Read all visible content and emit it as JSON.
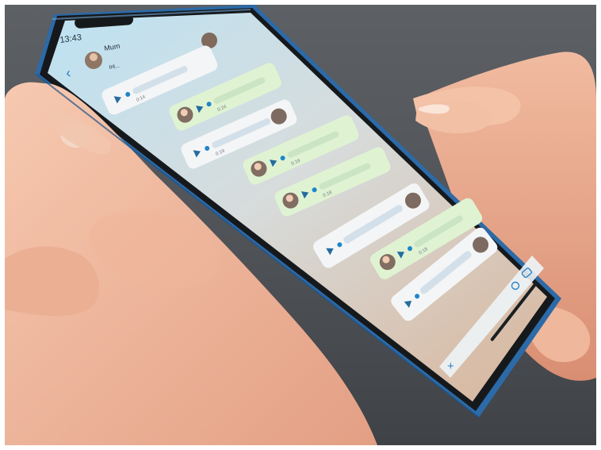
{
  "status_bar": {
    "time": "13:43"
  },
  "chat": {
    "contact_name": "Mum",
    "contact_status": "Inl...",
    "back_icon": "chevron-left-icon",
    "play_icon": "play-triangle-icon",
    "voice_messages": [
      {
        "sender": "contact",
        "duration": "0:14"
      },
      {
        "sender": "me",
        "duration": "0:24"
      },
      {
        "sender": "contact",
        "duration": "0:19"
      },
      {
        "sender": "me",
        "duration": "0:19"
      },
      {
        "sender": "me",
        "duration": "0:19"
      },
      {
        "sender": "contact",
        "duration": ""
      },
      {
        "sender": "me",
        "duration": "0:18"
      },
      {
        "sender": "contact",
        "duration": ""
      }
    ]
  },
  "input_bar": {
    "add_icon": "plus-icon",
    "mic_icon": "microphone-icon",
    "camera_icon": "camera-icon"
  },
  "colors": {
    "background": "#55585c",
    "phone_frame": "#2f6aa6",
    "screen_top": "#bfe0f1",
    "screen_bottom": "#dcb89a",
    "bubble_incoming": "#f4f5f6",
    "bubble_outgoing": "#dff3d3",
    "accent": "#1f86c9",
    "skin": "#eeb69a"
  }
}
